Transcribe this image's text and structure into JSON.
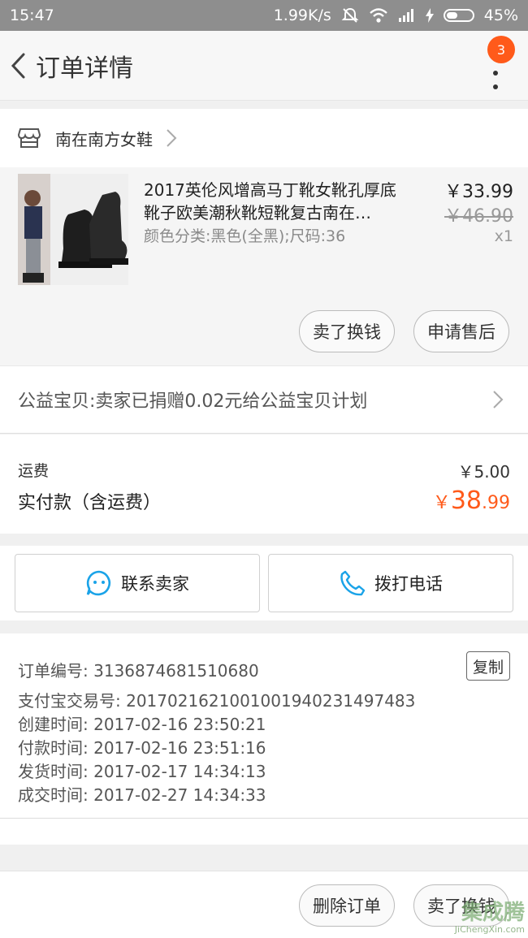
{
  "status_bar": {
    "time": "15:47",
    "network_speed": "1.99K/s",
    "battery": "45%"
  },
  "nav": {
    "title": "订单详情",
    "badge_count": "3"
  },
  "shop": {
    "name": "南在南方女鞋"
  },
  "product": {
    "title": "2017英伦风增高马丁靴女靴孔厚底靴子欧美潮秋靴短靴复古南在…",
    "spec": "颜色分类:黑色(全黑);尺码:36",
    "price": "￥33.99",
    "original_price": "￥46.90",
    "quantity": "x1",
    "sell_button": "卖了换钱",
    "aftersale_button": "申请售后"
  },
  "charity": {
    "text": "公益宝贝:卖家已捐赠0.02元给公益宝贝计划"
  },
  "fees": {
    "shipping_label": "运费",
    "shipping_value": "￥5.00",
    "paid_label": "实付款（含运费）",
    "paid_currency": "￥",
    "paid_int": "38",
    "paid_dec": ".99"
  },
  "contact": {
    "seller_button": "联系卖家",
    "call_button": "拨打电话"
  },
  "order_info": {
    "copy_button": "复制",
    "rows": [
      "订单编号: 3136874681510680",
      "支付宝交易号: 2017021621001001940231497483",
      "创建时间: 2017-02-16 23:50:21",
      "付款时间: 2017-02-16 23:51:16",
      "发货时间: 2017-02-17 14:34:13",
      "成交时间: 2017-02-27 14:34:33"
    ]
  },
  "bottom": {
    "delete_button": "删除订单",
    "sell_button": "卖了换钱"
  },
  "watermark": {
    "logo": "集成腾",
    "url": "JiChengXin.com"
  },
  "colors": {
    "accent": "#ff5a1a",
    "badge": "#ff5a1a",
    "icon_blue": "#1aa3e8"
  }
}
